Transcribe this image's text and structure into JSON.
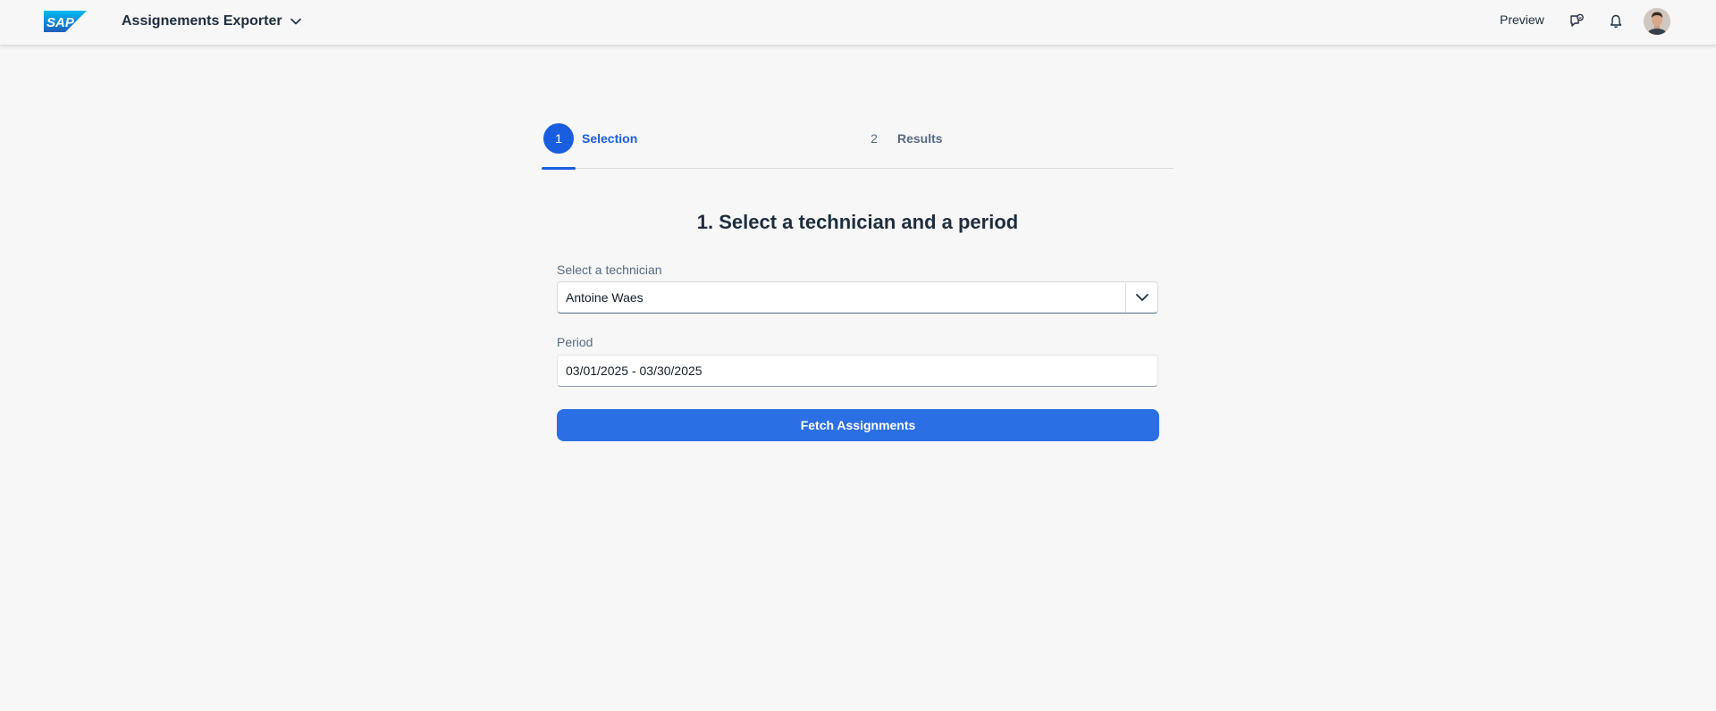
{
  "shellbar": {
    "logo_text": "SAP",
    "app_title": "Assignements Exporter",
    "preview_label": "Preview",
    "icons": [
      "chevron-down-icon",
      "feedback-icon",
      "bell-icon",
      "avatar"
    ]
  },
  "wizard": {
    "steps": [
      {
        "number": "1",
        "label": "Selection",
        "active": true
      },
      {
        "number": "2",
        "label": "Results",
        "active": false
      }
    ]
  },
  "form": {
    "heading": "1. Select a technician and a period",
    "technician_label": "Select a technician",
    "technician_value": "Antoine Waes",
    "period_label": "Period",
    "period_value": "03/01/2025 - 03/30/2025",
    "submit_label": "Fetch Assignments"
  },
  "colors": {
    "accent": "#1a5ee0",
    "button": "#2b6fe4",
    "background": "#f7f7f7",
    "text": "#1d2d3e",
    "muted": "#556b82"
  }
}
